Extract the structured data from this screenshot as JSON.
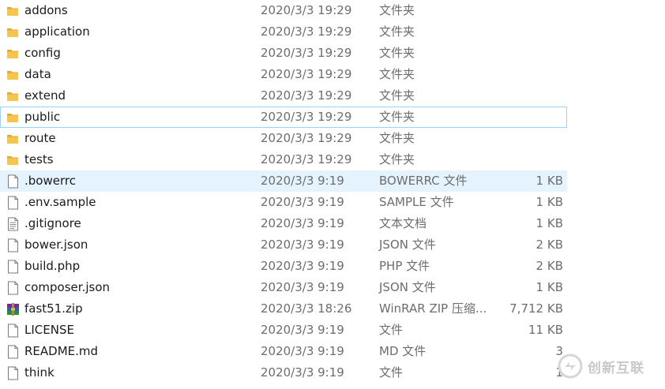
{
  "files": [
    {
      "name": "addons",
      "date": "2020/3/3 19:29",
      "type": "文件夹",
      "size": "",
      "icon": "folder-icon"
    },
    {
      "name": "application",
      "date": "2020/3/3 19:29",
      "type": "文件夹",
      "size": "",
      "icon": "folder-icon"
    },
    {
      "name": "config",
      "date": "2020/3/3 19:29",
      "type": "文件夹",
      "size": "",
      "icon": "folder-icon"
    },
    {
      "name": "data",
      "date": "2020/3/3 19:29",
      "type": "文件夹",
      "size": "",
      "icon": "folder-icon"
    },
    {
      "name": "extend",
      "date": "2020/3/3 19:29",
      "type": "文件夹",
      "size": "",
      "icon": "folder-icon"
    },
    {
      "name": "public",
      "date": "2020/3/3 19:29",
      "type": "文件夹",
      "size": "",
      "icon": "folder-icon"
    },
    {
      "name": "route",
      "date": "2020/3/3 19:29",
      "type": "文件夹",
      "size": "",
      "icon": "folder-icon"
    },
    {
      "name": "tests",
      "date": "2020/3/3 19:29",
      "type": "文件夹",
      "size": "",
      "icon": "folder-icon"
    },
    {
      "name": ".bowerrc",
      "date": "2020/3/3 9:19",
      "type": "BOWERRC 文件",
      "size": "1 KB",
      "icon": "file-icon"
    },
    {
      "name": ".env.sample",
      "date": "2020/3/3 9:19",
      "type": "SAMPLE 文件",
      "size": "1 KB",
      "icon": "file-icon"
    },
    {
      "name": ".gitignore",
      "date": "2020/3/3 9:19",
      "type": "文本文档",
      "size": "1 KB",
      "icon": "text-document-icon"
    },
    {
      "name": "bower.json",
      "date": "2020/3/3 9:19",
      "type": "JSON 文件",
      "size": "2 KB",
      "icon": "file-icon"
    },
    {
      "name": "build.php",
      "date": "2020/3/3 9:19",
      "type": "PHP 文件",
      "size": "2 KB",
      "icon": "file-icon"
    },
    {
      "name": "composer.json",
      "date": "2020/3/3 9:19",
      "type": "JSON 文件",
      "size": "1 KB",
      "icon": "file-icon"
    },
    {
      "name": "fast51.zip",
      "date": "2020/3/3 18:26",
      "type": "WinRAR ZIP 压缩...",
      "size": "7,712 KB",
      "icon": "winrar-archive-icon"
    },
    {
      "name": "LICENSE",
      "date": "2020/3/3 9:19",
      "type": "文件",
      "size": "11 KB",
      "icon": "file-icon"
    },
    {
      "name": "README.md",
      "date": "2020/3/3 9:19",
      "type": "MD 文件",
      "size": "3",
      "icon": "file-icon"
    },
    {
      "name": "think",
      "date": "2020/3/3 9:19",
      "type": "文件",
      "size": "1",
      "icon": "file-icon"
    }
  ],
  "selected_name": ".bowerrc",
  "focused_name": "public",
  "watermark": {
    "text": "创新互联",
    "icon": "chuangxin-logo-icon"
  },
  "colors": {
    "folder": "#f4c64e",
    "folder_dark": "#e3a82b",
    "selected_bg": "#e5f3ff",
    "focus_border": "#99d1ff",
    "secondary_text": "#6d6d6d"
  }
}
